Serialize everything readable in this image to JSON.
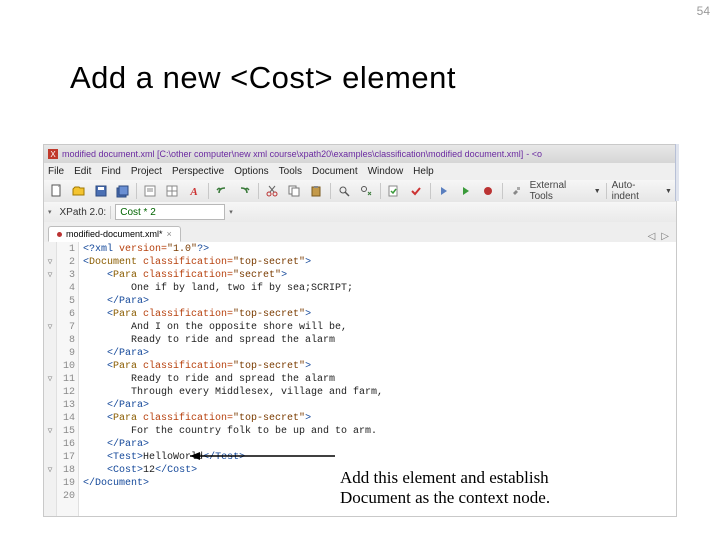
{
  "pageNumber": "54",
  "slideTitle": "Add a new <Cost> element",
  "titlebar": {
    "appPrefix": "X",
    "title": "modified document.xml [C:\\other computer\\new xml course\\xpath20\\examples\\classification\\modified document.xml]",
    "tail": " - <o"
  },
  "menu": [
    "File",
    "Edit",
    "Find",
    "Project",
    "Perspective",
    "Options",
    "Tools",
    "Document",
    "Window",
    "Help"
  ],
  "toolbar": {
    "externalTools": "External Tools",
    "format": "Auto-indent"
  },
  "xpath": {
    "label": "XPath 2.0:",
    "value": "Cost * 2"
  },
  "tab": {
    "label": "modified-document.xml*"
  },
  "code": {
    "fold": [
      "",
      "▽",
      "▽",
      "",
      "",
      "",
      "▽",
      "",
      "",
      "",
      "▽",
      "",
      "",
      "",
      "▽",
      "",
      "",
      "▽",
      "",
      "",
      ""
    ],
    "nums": [
      "1",
      "2",
      "3",
      "4",
      "5",
      "6",
      "7",
      "8",
      "9",
      "10",
      "11",
      "12",
      "13",
      "14",
      "15",
      "16",
      "17",
      "18",
      "19",
      "20"
    ],
    "lines": [
      {
        "ind": 0,
        "pre": "<?",
        "name": "xml",
        "attrs": " version=\"1.0\"",
        "post": "?>"
      },
      {
        "ind": 0,
        "pre": "<",
        "name": "Document",
        "attrs": " classification=\"top-secret\"",
        "post": ">",
        "hl": true
      },
      {
        "ind": 1,
        "pre": "<",
        "name": "Para",
        "attrs": " classification=\"secret\"",
        "post": ">",
        "hl": true
      },
      {
        "ind": 2,
        "text": "One if by land, two if by sea;SCRIPT;"
      },
      {
        "ind": 1,
        "pre": "</",
        "name": "Para",
        "post": ">"
      },
      {
        "ind": 1,
        "pre": "<",
        "name": "Para",
        "attrs": " classification=\"top-secret\"",
        "post": ">",
        "hl": true
      },
      {
        "ind": 2,
        "text": "And I on the opposite shore will be,"
      },
      {
        "ind": 2,
        "text": "Ready to ride and spread the alarm"
      },
      {
        "ind": 1,
        "pre": "</",
        "name": "Para",
        "post": ">"
      },
      {
        "ind": 1,
        "pre": "<",
        "name": "Para",
        "attrs": " classification=\"top-secret\"",
        "post": ">",
        "hl": true
      },
      {
        "ind": 2,
        "text": "Ready to ride and spread the alarm"
      },
      {
        "ind": 2,
        "text": "Through every Middlesex, village and farm,"
      },
      {
        "ind": 1,
        "pre": "</",
        "name": "Para",
        "post": ">"
      },
      {
        "ind": 1,
        "pre": "<",
        "name": "Para",
        "attrs": " classification=\"top-secret\"",
        "post": ">",
        "hl": true
      },
      {
        "ind": 2,
        "text": "For the country folk to be up and to arm."
      },
      {
        "ind": 1,
        "pre": "</",
        "name": "Para",
        "post": ">"
      },
      {
        "ind": 1,
        "pre": "<",
        "name": "Test",
        "post": ">",
        "inline": "HelloWorld",
        "close": "</Test>"
      },
      {
        "ind": 1,
        "pre": "<",
        "name": "Cost",
        "post": ">",
        "inline": "12",
        "close": "</Cost>"
      },
      {
        "ind": 0,
        "pre": "</",
        "name": "Document",
        "post": ">"
      },
      {
        "ind": 0,
        "text": ""
      }
    ]
  },
  "annotation": {
    "line1": "Add this element and establish",
    "line2": "Document as the context node."
  }
}
